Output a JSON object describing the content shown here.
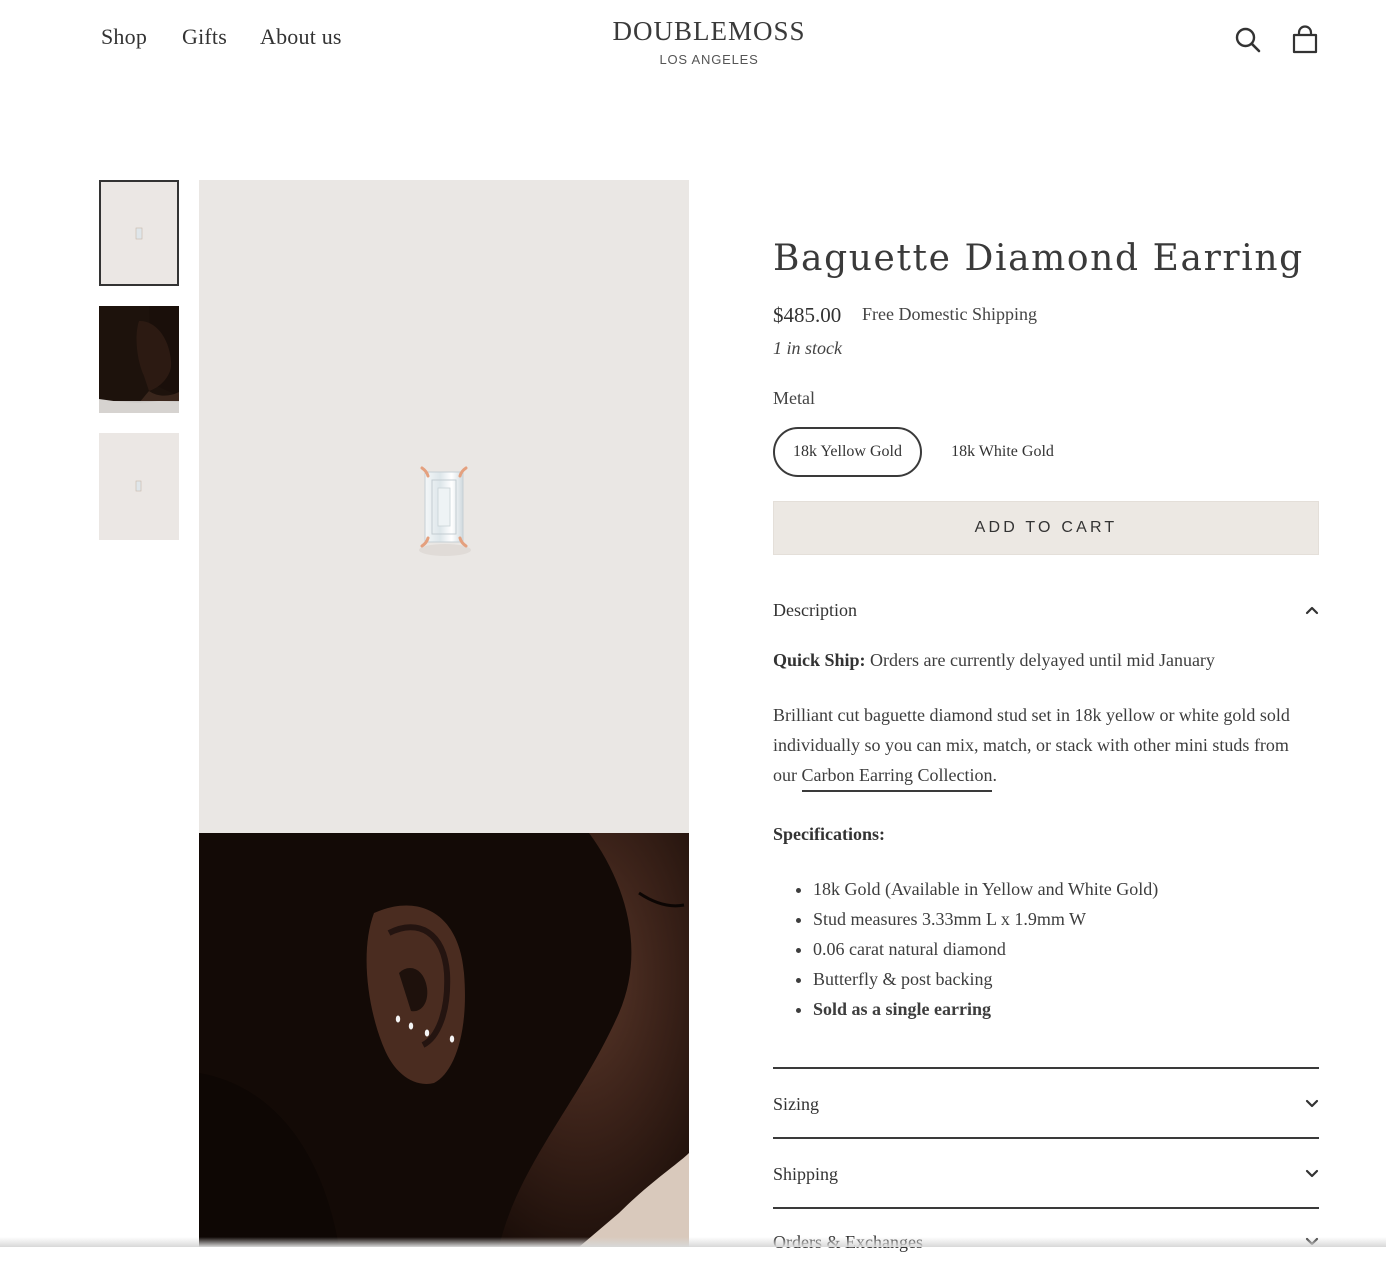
{
  "header": {
    "nav": [
      "Shop",
      "Gifts",
      "About us"
    ],
    "logo_name": "DOUBLEMOSS",
    "logo_sub": "LOS ANGELES",
    "icons": [
      "search-icon",
      "cart-icon"
    ]
  },
  "product": {
    "title": "Baguette Diamond Earring",
    "price": "$485.00",
    "shipping_note": "Free Domestic Shipping",
    "stock": "1 in stock",
    "metal_label": "Metal",
    "metal_options": [
      "18k Yellow Gold",
      "18k White Gold"
    ],
    "selected_metal": "18k Yellow Gold",
    "add_to_cart": "ADD TO CART"
  },
  "description": {
    "heading": "Description",
    "quick_ship_label": "Quick Ship:",
    "quick_ship_text": " Orders are currently delyayed until mid January",
    "body_line1": "Brilliant cut baguette diamond stud set in 18k yellow or white gold sold",
    "body_line2": "individually so you can mix, match, or stack with other mini studs from",
    "body_line3_prefix": "our ",
    "collection_link": "Carbon Earring Collection",
    "body_line3_suffix": ".",
    "spec_heading": "Specifications:",
    "specs": [
      "18k Gold (Available in Yellow and White Gold)",
      "Stud measures 3.33mm L x 1.9mm W",
      "0.06 carat natural diamond",
      "Butterfly & post backing",
      "Sold as a single earring"
    ]
  },
  "accordions": [
    "Sizing",
    "Shipping",
    "Orders & Exchanges"
  ],
  "colors": {
    "text": "#3a3a3a",
    "image_bg": "#eae7e4",
    "button_bg": "#ece8e3"
  }
}
